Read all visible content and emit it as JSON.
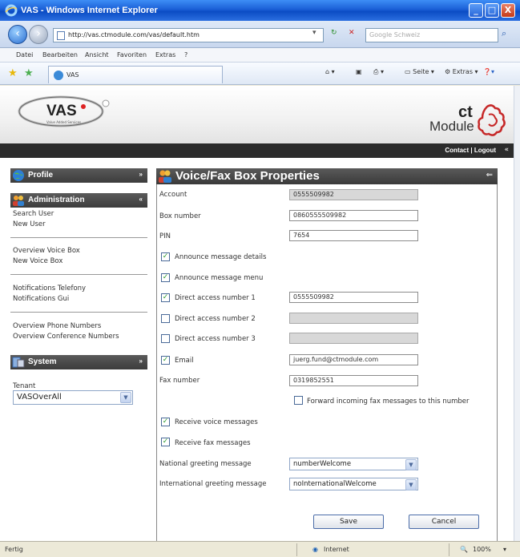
{
  "window": {
    "title": "VAS - Windows Internet Explorer",
    "minimize": "_",
    "maximize": "□",
    "close": "X"
  },
  "addressbar": {
    "url": "http://vas.ctmodule.com/vas/default.htm",
    "search_placeholder": "Google Schweiz",
    "refresh": "↻",
    "stop": "✕"
  },
  "menubar": [
    "Datei",
    "Bearbeiten",
    "Ansicht",
    "Favoriten",
    "Extras",
    "?"
  ],
  "tabbar": {
    "tab_title": "VAS",
    "seite": "Seite",
    "extras": "Extras"
  },
  "header": {
    "vas_logo": "VAS",
    "vas_tagline": "Value Added Services",
    "ct": "ct",
    "module": "Module",
    "contact": "Contact",
    "separator": "|",
    "logout": "Logout"
  },
  "sidebar": {
    "profile": "Profile",
    "administration": "Administration",
    "admin_links": [
      "Search User",
      "New User",
      "Overview Voice Box",
      "New Voice Box",
      "Notifications Telefony",
      "Notifications Gui",
      "Overview Phone Numbers",
      "Overview Conference Numbers"
    ],
    "system": "System",
    "tenant_label": "Tenant",
    "tenant_value": "VASOverAll"
  },
  "main": {
    "title": "Voice/Fax Box Properties",
    "account_label": "Account",
    "account_value": "0555509982",
    "box_number_label": "Box number",
    "box_number_value": "0860555509982",
    "pin_label": "PIN",
    "pin_value": "7654",
    "announce_details": "Announce message details",
    "announce_menu": "Announce message menu",
    "direct1_label": "Direct access number 1",
    "direct1_value": "0555509982",
    "direct2_label": "Direct access number 2",
    "direct3_label": "Direct access number 3",
    "email_label": "Email",
    "email_value": "juerg.fund@ctmodule.com",
    "fax_number_label": "Fax number",
    "fax_number_value": "0319852551",
    "forward_fax": "Forward incoming fax messages to this number",
    "receive_voice": "Receive voice messages",
    "receive_fax": "Receive fax messages",
    "national_label": "National greeting message",
    "national_value": "numberWelcome",
    "international_label": "International greeting message",
    "international_value": "noInternationalWelcome",
    "save": "Save",
    "cancel": "Cancel",
    "check": "✓"
  },
  "statusbar": {
    "status": "Fertig",
    "zone": "Internet",
    "zoom": "100%"
  }
}
